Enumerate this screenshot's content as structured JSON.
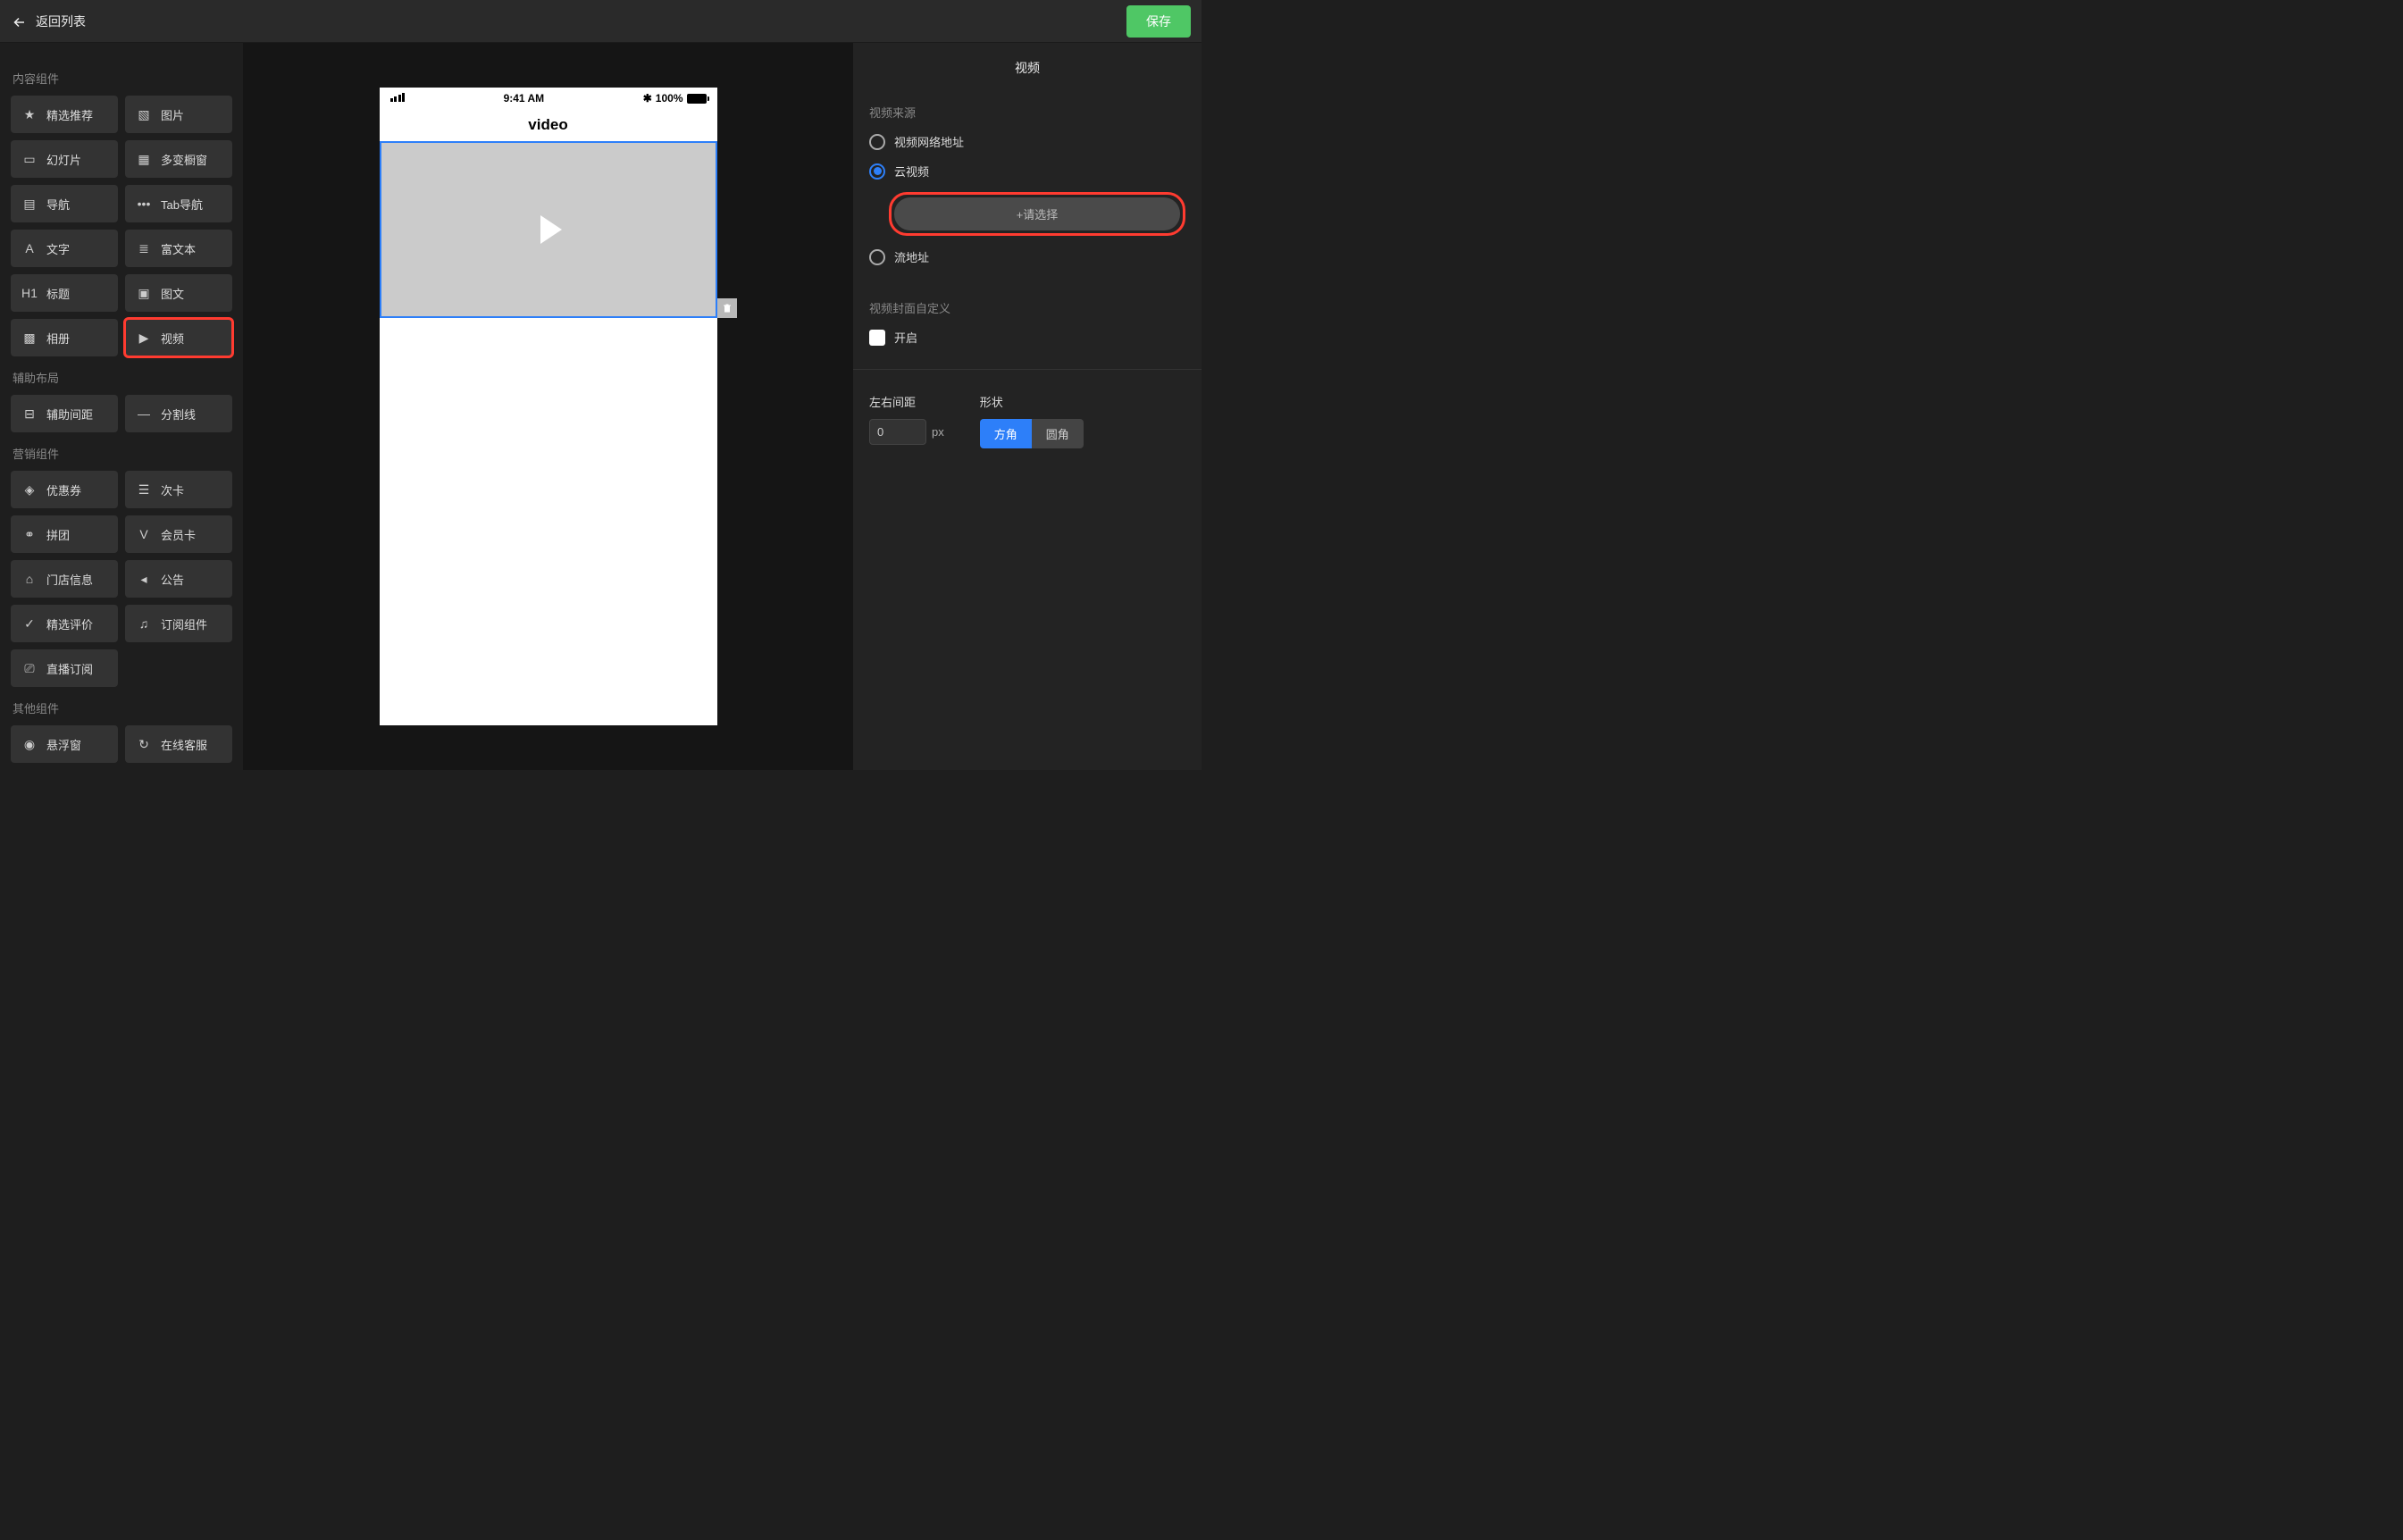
{
  "header": {
    "back_label": "返回列表",
    "save_label": "保存"
  },
  "left_panel": {
    "group_content_title": "内容组件",
    "content_items": [
      {
        "id": "featured",
        "label": "精选推荐"
      },
      {
        "id": "image",
        "label": "图片"
      },
      {
        "id": "slideshow",
        "label": "幻灯片"
      },
      {
        "id": "showcase",
        "label": "多变橱窗"
      },
      {
        "id": "nav",
        "label": "导航"
      },
      {
        "id": "tabnav",
        "label": "Tab导航"
      },
      {
        "id": "text",
        "label": "文字"
      },
      {
        "id": "richtext",
        "label": "富文本"
      },
      {
        "id": "heading",
        "label": "标题"
      },
      {
        "id": "imgtext",
        "label": "图文"
      },
      {
        "id": "album",
        "label": "相册"
      },
      {
        "id": "video",
        "label": "视频",
        "highlight": true
      }
    ],
    "group_layout_title": "辅助布局",
    "layout_items": [
      {
        "id": "spacer",
        "label": "辅助间距"
      },
      {
        "id": "divider",
        "label": "分割线"
      }
    ],
    "group_marketing_title": "营销组件",
    "marketing_items": [
      {
        "id": "coupon",
        "label": "优惠券"
      },
      {
        "id": "subcard",
        "label": "次卡"
      },
      {
        "id": "groupbuy",
        "label": "拼团"
      },
      {
        "id": "membercard",
        "label": "会员卡"
      },
      {
        "id": "storeinfo",
        "label": "门店信息"
      },
      {
        "id": "notice",
        "label": "公告"
      },
      {
        "id": "reviews",
        "label": "精选评价"
      },
      {
        "id": "subscribe",
        "label": "订阅组件"
      },
      {
        "id": "livesub",
        "label": "直播订阅"
      }
    ],
    "group_other_title": "其他组件",
    "other_items": [
      {
        "id": "float",
        "label": "悬浮窗"
      },
      {
        "id": "chat",
        "label": "在线客服"
      }
    ]
  },
  "phone": {
    "time": "9:41 AM",
    "battery_label": "100%",
    "title": "video"
  },
  "right_panel": {
    "title": "视频",
    "source_label": "视频来源",
    "radio_options": [
      {
        "id": "url",
        "label": "视频网络地址",
        "selected": false
      },
      {
        "id": "cloud",
        "label": "云视频",
        "selected": true
      },
      {
        "id": "stream",
        "label": "流地址",
        "selected": false
      }
    ],
    "select_button_label": "+请选择",
    "cover_section_label": "视频封面自定义",
    "cover_toggle_label": "开启",
    "margin_label": "左右间距",
    "margin_value": "0",
    "margin_unit": "px",
    "shape_label": "形状",
    "shape_options": [
      {
        "id": "square",
        "label": "方角",
        "active": true
      },
      {
        "id": "round",
        "label": "圆角",
        "active": false
      }
    ]
  }
}
